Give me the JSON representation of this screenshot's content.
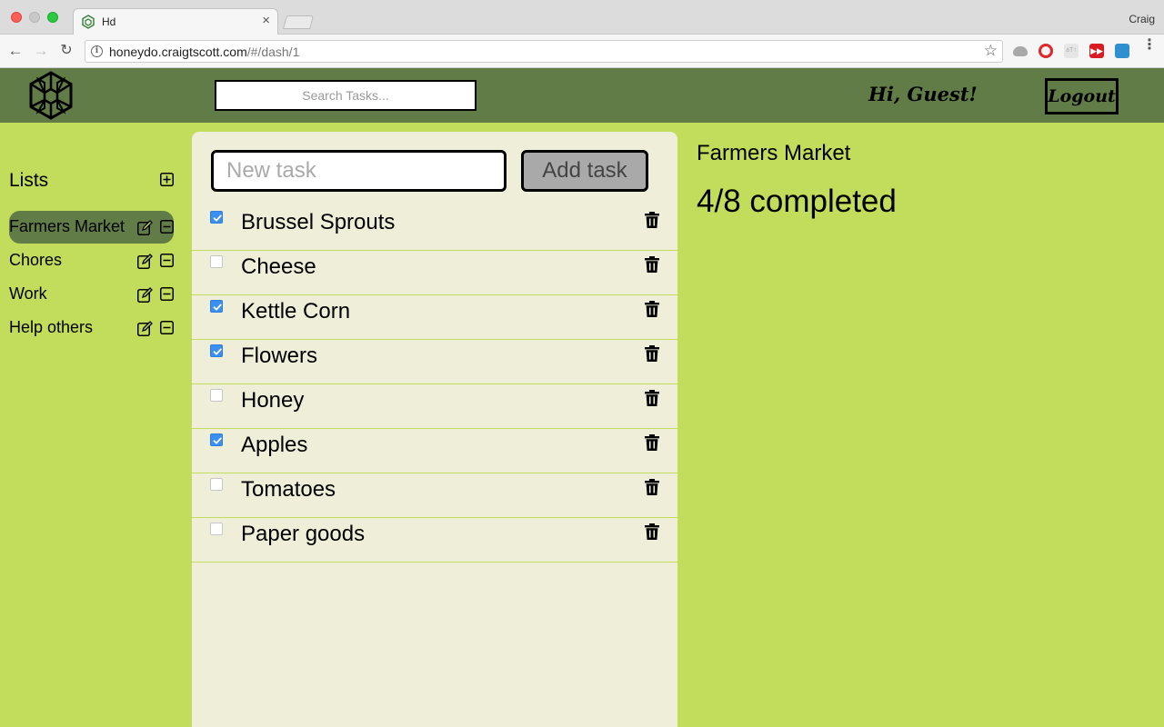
{
  "browser": {
    "tab_title": "Hd",
    "tab_close": "×",
    "profile_name": "Craig",
    "url_host": "honeydo.craigtscott.com",
    "url_path": "/#/dash/1",
    "info_glyph": "i",
    "star_glyph": "☆",
    "back_glyph": "←",
    "forward_glyph": "→",
    "reload_glyph": "↻",
    "menu_glyph": "⋮",
    "ext_grey_text": "aT↑",
    "ext_red_text": "▶▶"
  },
  "header": {
    "search_placeholder": "Search Tasks...",
    "greeting": "Hi, Guest!",
    "logout_label": "Logout"
  },
  "sidebar": {
    "heading": "Lists",
    "lists": [
      {
        "label": "Farmers Market",
        "active": true
      },
      {
        "label": "Chores",
        "active": false
      },
      {
        "label": "Work",
        "active": false
      },
      {
        "label": "Help others",
        "active": false
      }
    ]
  },
  "tasks": {
    "new_task_placeholder": "New task",
    "add_button_label": "Add task",
    "items": [
      {
        "name": "Brussel Sprouts",
        "done": true
      },
      {
        "name": "Cheese",
        "done": false
      },
      {
        "name": "Kettle Corn",
        "done": true
      },
      {
        "name": "Flowers",
        "done": true
      },
      {
        "name": "Honey",
        "done": false
      },
      {
        "name": "Apples",
        "done": true
      },
      {
        "name": "Tomatoes",
        "done": false
      },
      {
        "name": "Paper goods",
        "done": false
      }
    ]
  },
  "detail": {
    "title": "Farmers Market",
    "progress": "4/8 completed"
  },
  "colors": {
    "page_background": "#c2dc5b",
    "header_background": "#617c47",
    "panel_background": "#efefd9",
    "checkbox_checked": "#3b8ff0"
  },
  "icons": {
    "logo": "honeycomb-logo",
    "list_edit": "edit-icon",
    "list_remove": "minus-square-icon",
    "list_add": "plus-square-icon",
    "task_delete": "trash-icon"
  }
}
